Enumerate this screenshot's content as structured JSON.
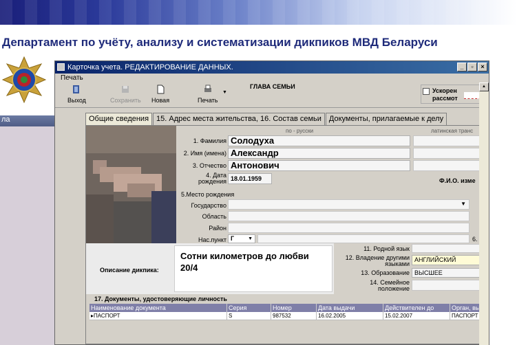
{
  "header": {
    "department": "Департамент по учёту, анализу и систематизации дикпиков МВД Беларуси"
  },
  "left_pane": {
    "title": "ла",
    "collapse_icon": "double-chevron-up-icon"
  },
  "window": {
    "title": "Карточка учета. РЕДАКТИРОВАНИЕ ДАННЫХ.",
    "menu": [
      "Печать"
    ],
    "toolbar": {
      "exit": "Выход",
      "save": "Сохранить",
      "new": "Новая",
      "print": "Печать"
    },
    "head_of_family": "ГЛАВА СЕМЬИ",
    "quick_view": {
      "line1": "Ускорен",
      "line2": "рассмот"
    },
    "tabs": [
      "Общие сведения",
      "15. Адрес места жительства, 16. Состав семьи",
      "Документы, прилагаемые к делу"
    ]
  },
  "form": {
    "col_russian": "по - русски",
    "col_latin": "латинская транс",
    "surname_label": "1. Фамилия",
    "surname": "Солодуха",
    "name_label": "2. Имя (имена)",
    "name": "Александр",
    "patronymic_label": "3. Отчество",
    "patronymic": "Антонович",
    "birth_label1": "4. Дата",
    "birth_label2": "рождения",
    "birth_date": "18.01.1959",
    "fio_label": "Ф.И.О. изме",
    "birthplace_label": "5.Место рождения",
    "state_label": "Государство",
    "region_label": "Область",
    "district_label": "Район",
    "settlement_label": "Нас.пункт",
    "settlement_type": "Г",
    "field6_label": "6.",
    "description_label": "Описание дикпика:",
    "description": "Сотни километров до любви 20/4",
    "native_lang_label": "11. Родной язык",
    "other_lang_label1": "12. Владение другими",
    "other_lang_label2": "языками",
    "other_lang": "АНГЛИЙСКИЙ",
    "education_label": "13. Образование",
    "education": "ВЫСШЕЕ",
    "family_label1": "14. Семейное",
    "family_label2": "положение"
  },
  "documents": {
    "title": "17. Документы, удостоверяющие личность",
    "columns": [
      "Наименование документа",
      "Серия",
      "Номер",
      "Дата выдачи",
      "Действителен до",
      "Орган, вы"
    ],
    "rows": [
      [
        "ПАСПОРТ",
        "S",
        "987532",
        "16.02.2005",
        "15.02.2007",
        "ПАСПОРТ"
      ]
    ]
  }
}
